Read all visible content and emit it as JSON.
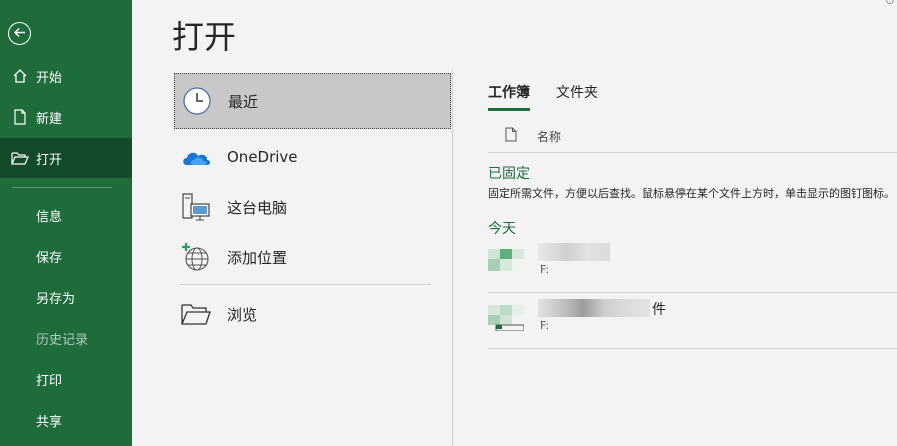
{
  "sidebar": {
    "back_icon": "arrow-left-icon",
    "items": [
      {
        "label": "开始",
        "icon": "home-icon"
      },
      {
        "label": "新建",
        "icon": "new-document-icon"
      },
      {
        "label": "打开",
        "icon": "open-folder-icon",
        "active": true
      },
      {
        "label": "信息"
      },
      {
        "label": "保存"
      },
      {
        "label": "另存为"
      },
      {
        "label": "历史记录",
        "disabled": true
      },
      {
        "label": "打印"
      },
      {
        "label": "共享"
      }
    ]
  },
  "main": {
    "title": "打开",
    "locations": [
      {
        "label": "最近",
        "icon": "clock-icon",
        "selected": true
      },
      {
        "label": "OneDrive",
        "icon": "onedrive-cloud-icon"
      },
      {
        "label": "这台电脑",
        "icon": "this-pc-icon"
      },
      {
        "label": "添加位置",
        "icon": "add-location-globe-icon"
      },
      {
        "label": "浏览",
        "icon": "folder-icon"
      }
    ],
    "tabs": [
      {
        "label": "工作簿",
        "active": true
      },
      {
        "label": "文件夹"
      }
    ],
    "column_header": {
      "icon": "file-icon",
      "name_label": "名称"
    },
    "pinned": {
      "title": "已固定",
      "description": "固定所需文件，方便以后查找。鼠标悬停在某个文件上方时，单击显示的图钉图标。"
    },
    "today": {
      "title": "今天",
      "files": [
        {
          "name_visible": "",
          "path": "F:",
          "icon": "excel-file-icon"
        },
        {
          "name_visible": "件",
          "path": "F:",
          "icon": "excel-file-icon"
        }
      ]
    }
  },
  "colors": {
    "sidebar_bg": "#1e6b3c",
    "sidebar_active": "#134a29",
    "accent": "#1e6b3c",
    "selected_bg": "#c8c8c8"
  }
}
